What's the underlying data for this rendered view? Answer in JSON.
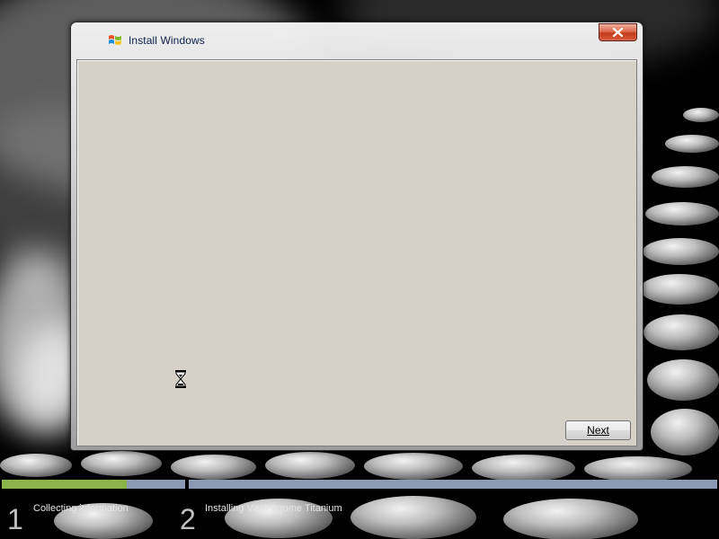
{
  "window": {
    "title": "Install Windows",
    "title_icon": "windows-flag-icon",
    "close_icon": "close-icon"
  },
  "content": {
    "busy_icon": "hourglass-icon",
    "background_color": "#d5d1c9"
  },
  "buttons": {
    "next_label": "Next"
  },
  "steps": [
    {
      "number": "1",
      "label": "Collecting information",
      "progress": 0.68
    },
    {
      "number": "2",
      "label": "Installing Vista Agome Titanium",
      "progress": 0.0
    }
  ],
  "colors": {
    "progress_done": "#8ab44a",
    "progress_pending": "#8b9bb2",
    "close_button": "#c23a1b",
    "title_text": "#0b1e4a"
  }
}
